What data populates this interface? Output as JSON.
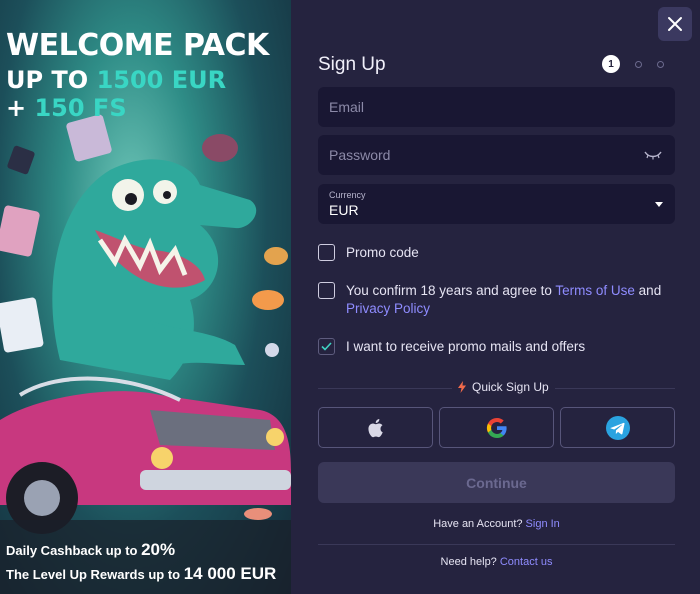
{
  "promo": {
    "title": "WELCOME PACK",
    "line1_prefix": "UP TO ",
    "line1_highlight": "1500 EUR",
    "line2_prefix": "+ ",
    "line2_highlight": "150 FS",
    "cashback_text": "Daily Cashback up to ",
    "cashback_value": "20%",
    "levelup_text": "The Level Up Rewards up to ",
    "levelup_value": "14 000 EUR",
    "highlight_color": "#39d6c4"
  },
  "form": {
    "heading": "Sign Up",
    "steps": [
      "1",
      "",
      ""
    ],
    "active_step": 1,
    "email_placeholder": "Email",
    "password_placeholder": "Password",
    "currency_label": "Currency",
    "currency_value": "EUR",
    "promo_code_label": "Promo code",
    "promo_code_checked": false,
    "terms_text_1": "You confirm 18 years and agree to ",
    "terms_link": "Terms of Use",
    "terms_text_2": " and ",
    "privacy_link": "Privacy Policy",
    "terms_checked": false,
    "mail_label": "I want to receive promo mails and offers",
    "mail_checked": true,
    "quick_signup_label": "Quick Sign Up",
    "social_buttons": [
      "apple-icon",
      "google-icon",
      "telegram-icon"
    ],
    "continue_label": "Continue",
    "have_account_text": "Have an Account? ",
    "sign_in_link": "Sign In",
    "need_help_text": "Need help? ",
    "contact_link": "Contact us",
    "link_color": "#8f8cff"
  }
}
